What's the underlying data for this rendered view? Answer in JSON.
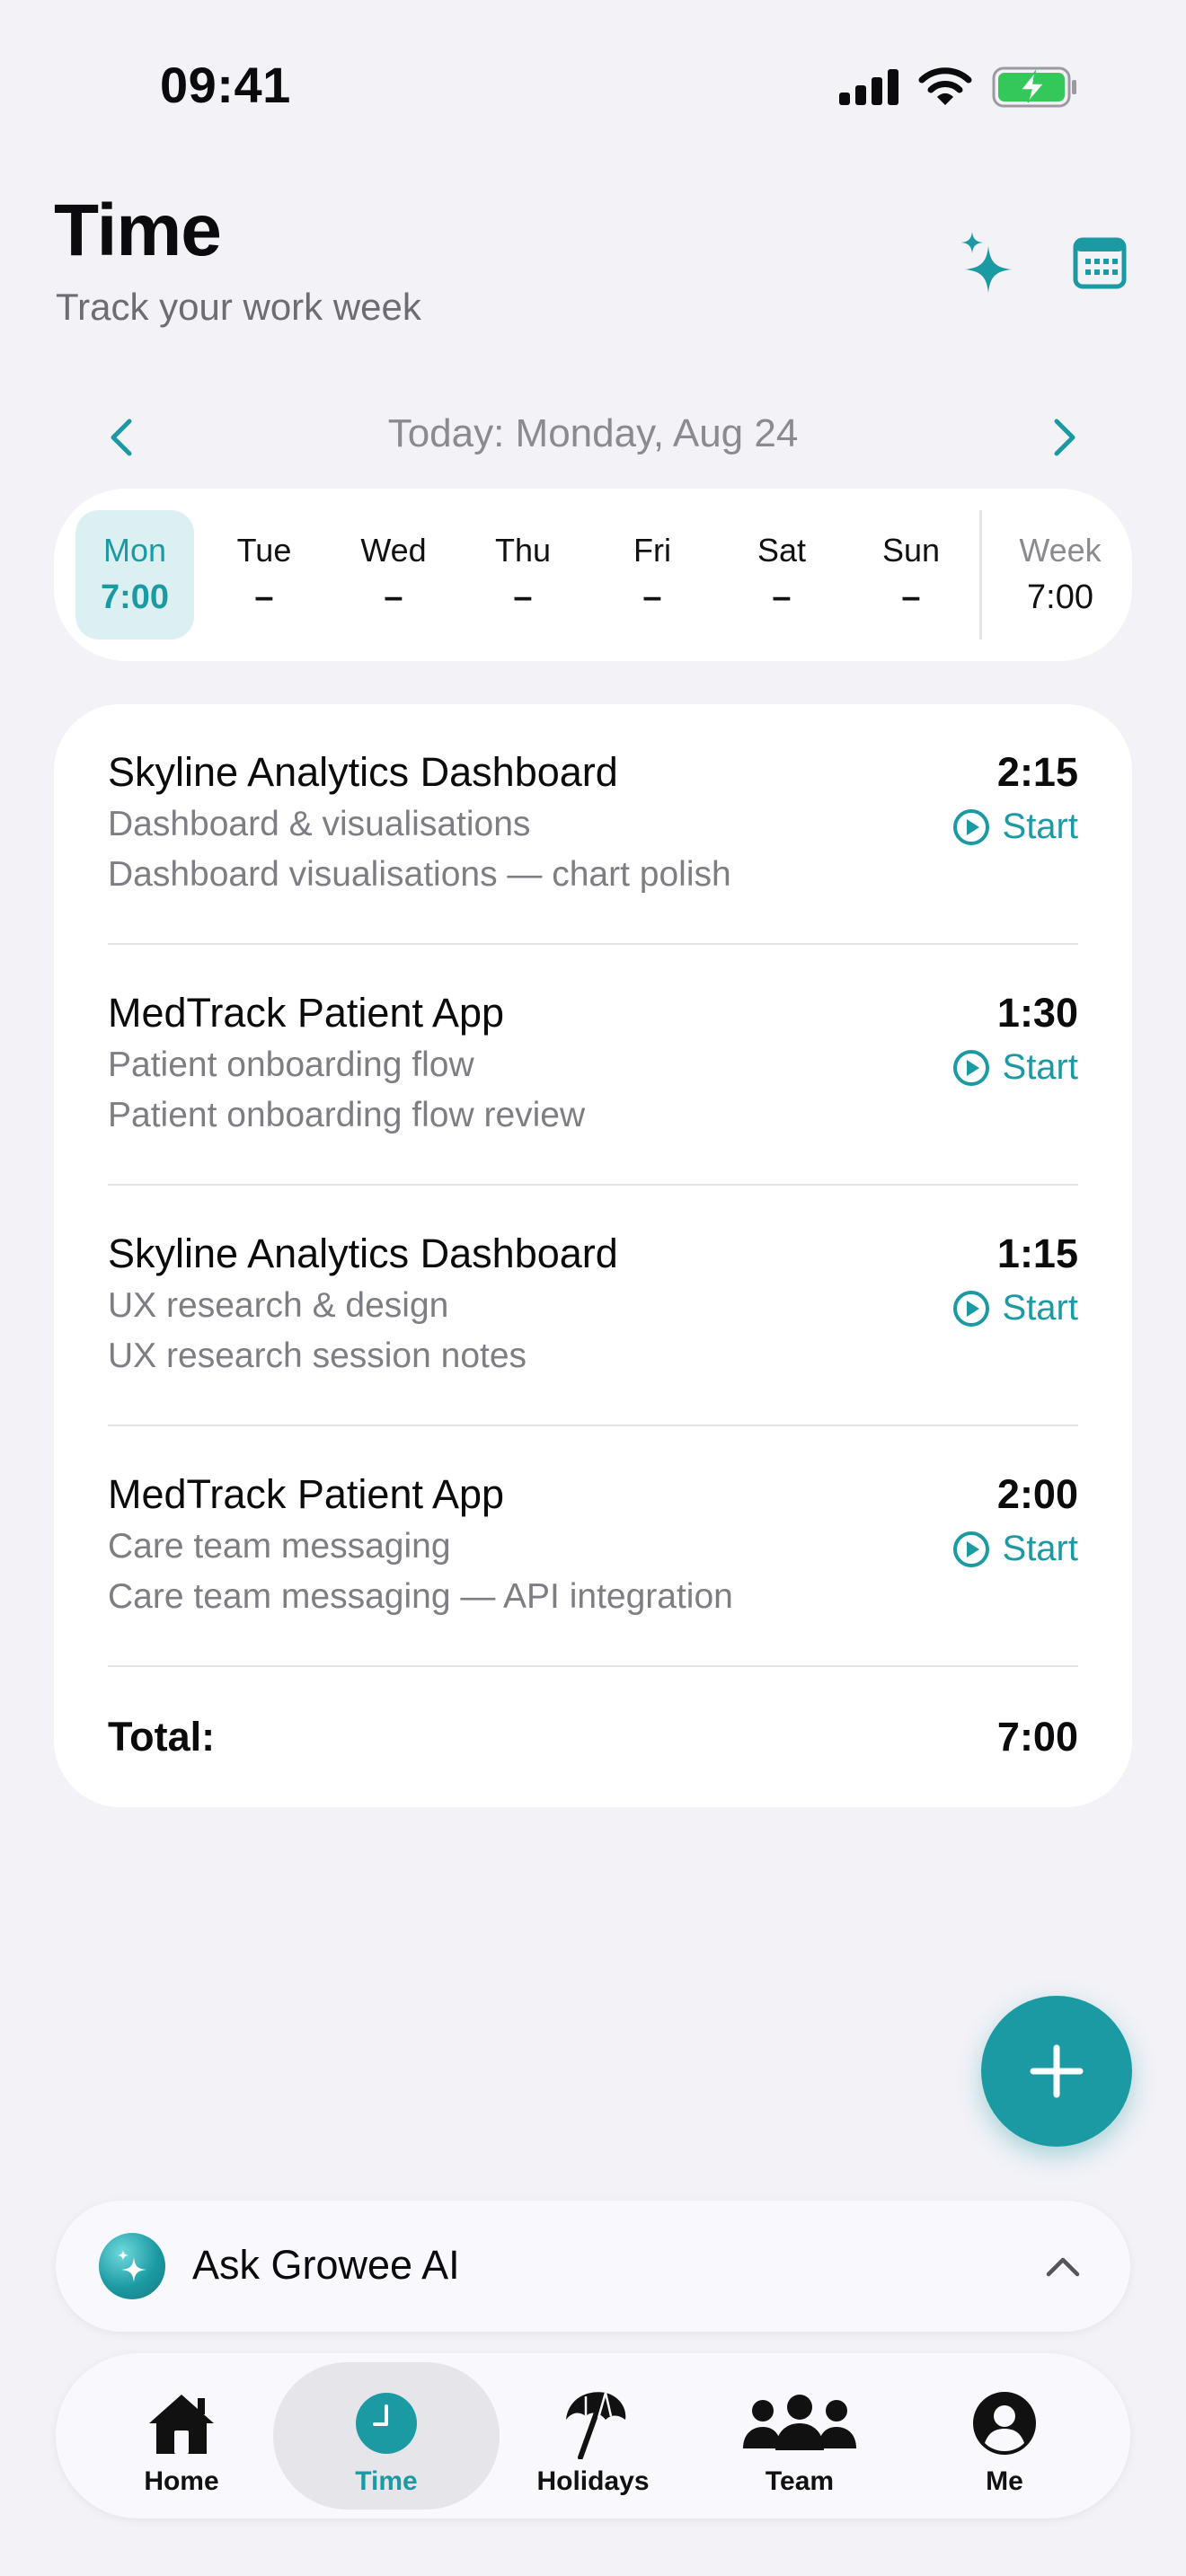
{
  "status_bar": {
    "time": "09:41"
  },
  "header": {
    "title": "Time",
    "subtitle": "Track your work week"
  },
  "date_nav": {
    "label": "Today: Monday, Aug 24"
  },
  "week": {
    "days": [
      {
        "name": "Mon",
        "value": "7:00",
        "active": true
      },
      {
        "name": "Tue",
        "value": "–"
      },
      {
        "name": "Wed",
        "value": "–"
      },
      {
        "name": "Thu",
        "value": "–"
      },
      {
        "name": "Fri",
        "value": "–"
      },
      {
        "name": "Sat",
        "value": "–"
      },
      {
        "name": "Sun",
        "value": "–"
      }
    ],
    "total_label": "Week",
    "total_value": "7:00"
  },
  "entries": [
    {
      "project": "Skyline Analytics Dashboard",
      "task": "Dashboard & visualisations",
      "note": "Dashboard visualisations — chart polish",
      "duration": "2:15",
      "action": "Start"
    },
    {
      "project": "MedTrack Patient App",
      "task": "Patient onboarding flow",
      "note": "Patient onboarding flow review",
      "duration": "1:30",
      "action": "Start"
    },
    {
      "project": "Skyline Analytics Dashboard",
      "task": "UX research & design",
      "note": "UX research session notes",
      "duration": "1:15",
      "action": "Start"
    },
    {
      "project": "MedTrack Patient App",
      "task": "Care team messaging",
      "note": "Care team messaging — API integration",
      "duration": "2:00",
      "action": "Start"
    }
  ],
  "total": {
    "label": "Total:",
    "value": "7:00"
  },
  "ai_bar": {
    "label": "Ask Growee AI"
  },
  "tabs": [
    {
      "label": "Home",
      "icon": "home-icon"
    },
    {
      "label": "Time",
      "icon": "clock-icon",
      "active": true
    },
    {
      "label": "Holidays",
      "icon": "umbrella-icon"
    },
    {
      "label": "Team",
      "icon": "team-icon"
    },
    {
      "label": "Me",
      "icon": "profile-icon"
    }
  ],
  "colors": {
    "accent": "#1c9aa3",
    "background": "#f2f2f7",
    "card": "#ffffff",
    "battery": "#34c759"
  }
}
